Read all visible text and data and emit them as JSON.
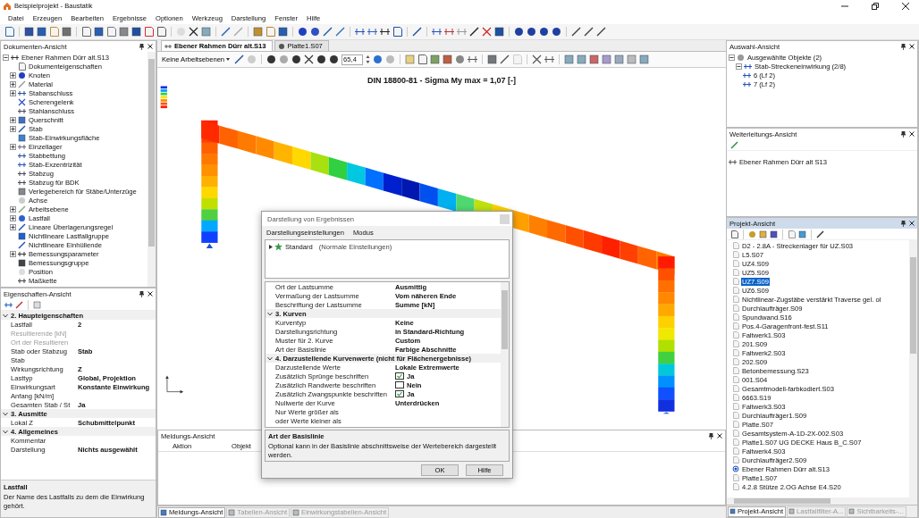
{
  "window": {
    "title": "Beispielprojekt - Baustatik"
  },
  "menu": [
    "Datei",
    "Erzeugen",
    "Bearbeiten",
    "Ergebnisse",
    "Optionen",
    "Werkzeug",
    "Darstellung",
    "Fenster",
    "Hilfe"
  ],
  "document_view": {
    "title": "Dokumenten-Ansicht",
    "active": false,
    "tree": [
      {
        "label": "Ebener Rahmen Dürr alt.S13",
        "expanded": true,
        "children": [
          {
            "label": "Dokumenteigenschaften",
            "expandable": false
          },
          {
            "label": "Knoten",
            "expandable": true
          },
          {
            "label": "Material",
            "expandable": true
          },
          {
            "label": "Stabanschluss",
            "expandable": true
          },
          {
            "label": "Scherengelenk",
            "expandable": false
          },
          {
            "label": "Stahlanschluss",
            "expandable": false
          },
          {
            "label": "Querschnitt",
            "expandable": true
          },
          {
            "label": "Stab",
            "expandable": true
          },
          {
            "label": "Stab-Einwirkungsfläche",
            "expandable": false
          },
          {
            "label": "Einzellager",
            "expandable": true
          },
          {
            "label": "Stabbettung",
            "expandable": false
          },
          {
            "label": "Stab-Exzentrizität",
            "expandable": false
          },
          {
            "label": "Stabzug",
            "expandable": false
          },
          {
            "label": "Stabzug für BDK",
            "expandable": false
          },
          {
            "label": "Verlegebereich für Stäbe/Unterzüge",
            "expandable": false
          },
          {
            "label": "Achse",
            "expandable": false
          },
          {
            "label": "Arbeitsebene",
            "expandable": true
          },
          {
            "label": "Lastfall",
            "expandable": true
          },
          {
            "label": "Lineare Überlagerungsregel",
            "expandable": true
          },
          {
            "label": "Nichtlineare Lastfallgruppe",
            "expandable": false
          },
          {
            "label": "Nichtlineare Einhüllende",
            "expandable": false
          },
          {
            "label": "Bemessungsparameter",
            "expandable": true
          },
          {
            "label": "Bemessungsgruppe",
            "expandable": false
          },
          {
            "label": "Position",
            "expandable": false
          },
          {
            "label": "Maßkette",
            "expandable": false
          }
        ]
      }
    ]
  },
  "properties_view": {
    "title": "Eigenschaften-Ansicht",
    "active": false,
    "rows": [
      {
        "kind": "section",
        "label": "2. Haupteigenschaften",
        "expanded": true
      },
      {
        "kind": "row",
        "label": "Lastfall",
        "value": "2",
        "disabled": false
      },
      {
        "kind": "row",
        "label": "Resultierende [kN]",
        "disabled": true
      },
      {
        "kind": "row",
        "label": "Ort der Resultieren",
        "disabled": true
      },
      {
        "kind": "row",
        "label": "Stab oder Stabzug",
        "value": "Stab",
        "disabled": false
      },
      {
        "kind": "row",
        "label": "Stab",
        "disabled": false
      },
      {
        "kind": "row",
        "label": "Wirkungsrichtung",
        "value": "Z",
        "disabled": false
      },
      {
        "kind": "row",
        "label": "Lasttyp",
        "value": "Global, Projektion",
        "disabled": false
      },
      {
        "kind": "row",
        "label": "Einwirkungsart",
        "value": "Konstante Einwirkung",
        "disabled": false
      },
      {
        "kind": "row",
        "label": "Anfang [kN/m]",
        "disabled": false
      },
      {
        "kind": "row",
        "label": "Gesamten Stab / St",
        "value": "Ja",
        "disabled": false
      },
      {
        "kind": "section",
        "label": "3. Ausmitte",
        "expanded": true
      },
      {
        "kind": "row",
        "label": "Lokal Z",
        "value": "Schubmittelpunkt",
        "disabled": false
      },
      {
        "kind": "section",
        "label": "4. Allgemeines",
        "expanded": true
      },
      {
        "kind": "row",
        "label": "Kommentar",
        "disabled": false
      },
      {
        "kind": "row",
        "label": "Darstellung",
        "value": "Nichts ausgewählt",
        "disabled": false
      }
    ],
    "description": {
      "title": "Lastfall",
      "text": "Der Name des Lastfalls zu dem die Einwirkung gehört."
    }
  },
  "document_tabs": [
    {
      "label": "Ebener Rahmen Dürr alt.S13",
      "selected": true
    },
    {
      "label": "Platte1.S07",
      "selected": false
    }
  ],
  "view_toolbar": {
    "workplane": "Keine Arbeitsebenen",
    "zoom": "65,4"
  },
  "chart_title": "DIN 18800-81 - Sigma My max = 1,07 [-]",
  "message_view": {
    "title": "Meldungs-Ansicht",
    "active": false,
    "columns": [
      "Aktion",
      "Objekt"
    ]
  },
  "bottom_tabs": [
    {
      "label": "Meldungs-Ansicht",
      "selected": true,
      "disabled": false
    },
    {
      "label": "Tabellen-Ansicht",
      "selected": false,
      "disabled": true
    },
    {
      "label": "Einwirkungstabellen-Ansicht",
      "selected": false,
      "disabled": true
    }
  ],
  "dialog": {
    "title": "Darstellung von Ergebnissen",
    "menu": [
      "Darstellungseinstellungen",
      "Modus"
    ],
    "tree": [
      {
        "label": "Standard",
        "note": "(Normale Einstellungen)"
      }
    ],
    "rows": [
      {
        "kind": "row",
        "label": "Ort der Lastsumme",
        "value": "Ausmittig"
      },
      {
        "kind": "row",
        "label": "Vermaßung der Lastsumme",
        "value": "Vom näheren Ende"
      },
      {
        "kind": "row",
        "label": "Beschriftung der Lastsumme",
        "value": "Summe [kN]"
      },
      {
        "kind": "section",
        "label": "3. Kurven",
        "expanded": true
      },
      {
        "kind": "row",
        "label": "Kurventyp",
        "value": "Keine"
      },
      {
        "kind": "row",
        "label": "Darstellungsrichtung",
        "value": "in Standard-Richtung"
      },
      {
        "kind": "row",
        "label": "Muster für 2. Kurve",
        "value": "Custom"
      },
      {
        "kind": "row",
        "label": "Art der Basislinie",
        "value": "Farbige Abschnitte"
      },
      {
        "kind": "section",
        "label": "4. Darzustellende Kurvenwerte (nicht für Flächenergebnisse)",
        "expanded": true
      },
      {
        "kind": "row",
        "label": "Darzustellende Werte",
        "value": "Lokale Extremwerte"
      },
      {
        "kind": "check",
        "label": "Zusätzlich Sprünge beschriften",
        "value": "Ja",
        "checked": true
      },
      {
        "kind": "check",
        "label": "Zusätzlich Randwerte beschriften",
        "value": "Nein",
        "checked": false
      },
      {
        "kind": "check",
        "label": "Zusätzlich Zwangspunkte beschriften",
        "value": "Ja",
        "checked": true
      },
      {
        "kind": "row",
        "label": "Nullwerte der Kurve",
        "value": "Unterdrücken"
      },
      {
        "kind": "row",
        "label": "Nur Werte größer als"
      },
      {
        "kind": "row",
        "label": "oder Werte kleiner als"
      }
    ],
    "description": {
      "title": "Art der Basislinie",
      "text": "Optional kann in der Basislinie abschnittsweise der Wertebereich dargestellt werden."
    },
    "buttons": [
      "OK",
      "Hilfe"
    ]
  },
  "selection_view": {
    "title": "Auswahl-Ansicht",
    "active": false,
    "tree": [
      {
        "label": "Ausgewählte Objekte (2)",
        "children": [
          {
            "label": "Stab-Streckeneinwirkung (2/8)",
            "children": [
              {
                "label": "6 (Lf 2)"
              },
              {
                "label": "7 (Lf 2)"
              }
            ]
          }
        ]
      }
    ]
  },
  "forwarding_view": {
    "title": "Weiterleitungs-Ansicht",
    "active": false,
    "items": [
      "Ebener Rahmen Dürr alt S13"
    ]
  },
  "project_view": {
    "title": "Projekt-Ansicht",
    "active": true,
    "items": [
      {
        "label": "D2 - 2.8A - Streckenlager für UZ.S03",
        "selected": false,
        "open": false
      },
      {
        "label": "L5.S07",
        "selected": false,
        "open": false
      },
      {
        "label": "UZ4.S09",
        "selected": false,
        "open": false
      },
      {
        "label": "UZ5.S09",
        "selected": false,
        "open": false
      },
      {
        "label": "UZ7.S09",
        "selected": true,
        "open": false
      },
      {
        "label": "UZ6.S09",
        "selected": false,
        "open": false
      },
      {
        "label": "Nichtlinear-Zugstäbe verstärkt Traverse gel. ol",
        "selected": false,
        "open": false
      },
      {
        "label": "Durchlaufträger.S09",
        "selected": false,
        "open": false
      },
      {
        "label": "Spundwand.S16",
        "selected": false,
        "open": false
      },
      {
        "label": "Pos.4-Garagenfront-fest.S11",
        "selected": false,
        "open": false
      },
      {
        "label": "Faltwerk1.S03",
        "selected": false,
        "open": false
      },
      {
        "label": "201.S09",
        "selected": false,
        "open": false
      },
      {
        "label": "Faltwerk2.S03",
        "selected": false,
        "open": false
      },
      {
        "label": "202.S09",
        "selected": false,
        "open": false
      },
      {
        "label": "Betonbemessung.S23",
        "selected": false,
        "open": false
      },
      {
        "label": "001.S04",
        "selected": false,
        "open": false
      },
      {
        "label": "Gesamtmodell-farbkodiert.S03",
        "selected": false,
        "open": false
      },
      {
        "label": "6663.S19",
        "selected": false,
        "open": false
      },
      {
        "label": "Faltwerk3.S03",
        "selected": false,
        "open": false
      },
      {
        "label": "Durchlaufträger1.S09",
        "selected": false,
        "open": false
      },
      {
        "label": "Platte.S07",
        "selected": false,
        "open": false
      },
      {
        "label": "Gesamtsystem-A-1D-2X-002.S03",
        "selected": false,
        "open": false
      },
      {
        "label": "Platte1.S07  UG DECKE Haus B_C.S07",
        "selected": false,
        "open": false
      },
      {
        "label": "Faltwerk4.S03",
        "selected": false,
        "open": false
      },
      {
        "label": "Durchlaufträger2.S09",
        "selected": false,
        "open": false
      },
      {
        "label": "Ebener Rahmen Dürr alt.S13",
        "selected": false,
        "open": true
      },
      {
        "label": "Platte1.S07",
        "selected": false,
        "open": false
      },
      {
        "label": "4.2.8  Stütze 2.OG Achse E4.S20",
        "selected": false,
        "open": false
      }
    ]
  },
  "right_tabs": [
    {
      "label": "Projekt-Ansicht",
      "selected": true,
      "disabled": false
    },
    {
      "label": "Lastfallfilter-A...",
      "selected": false,
      "disabled": true
    },
    {
      "label": "Sichtbarkeits-...",
      "selected": false,
      "disabled": true
    }
  ]
}
